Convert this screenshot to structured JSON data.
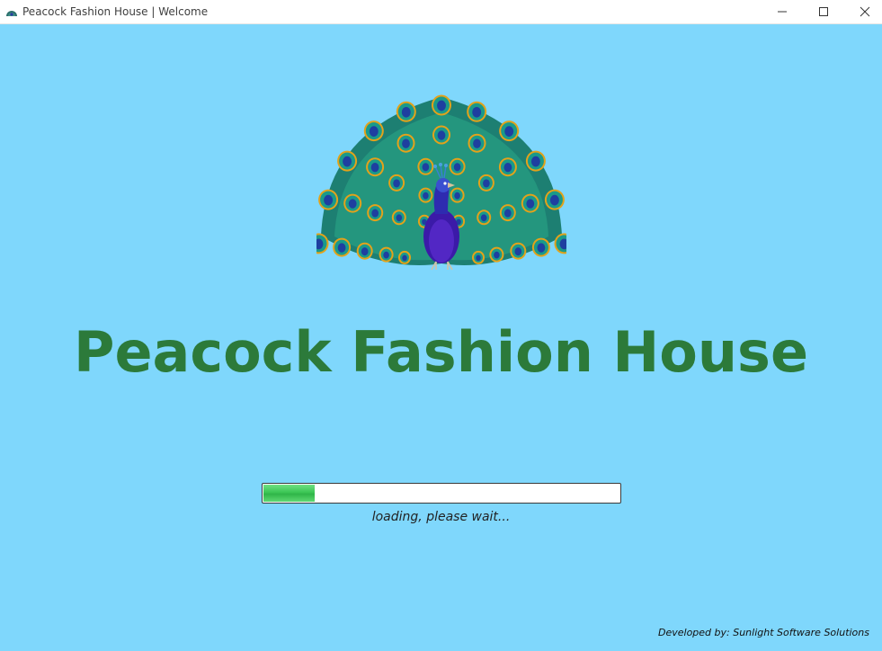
{
  "window": {
    "title": "Peacock Fashion House | Welcome",
    "icon": "peacock-app-icon",
    "controls": {
      "minimize_icon": "minimize-icon",
      "maximize_icon": "maximize-icon",
      "close_icon": "close-icon"
    }
  },
  "splash": {
    "logo_icon": "peacock-logo",
    "app_name": "Peacock Fashion House",
    "loading_text": "loading, please wait...",
    "progress_fraction": 0.145,
    "credits": "Developed by: Sunlight Software Solutions"
  },
  "colors": {
    "background": "#7fd7fc",
    "title": "#2c7a3a",
    "progress": "#3cc655"
  }
}
